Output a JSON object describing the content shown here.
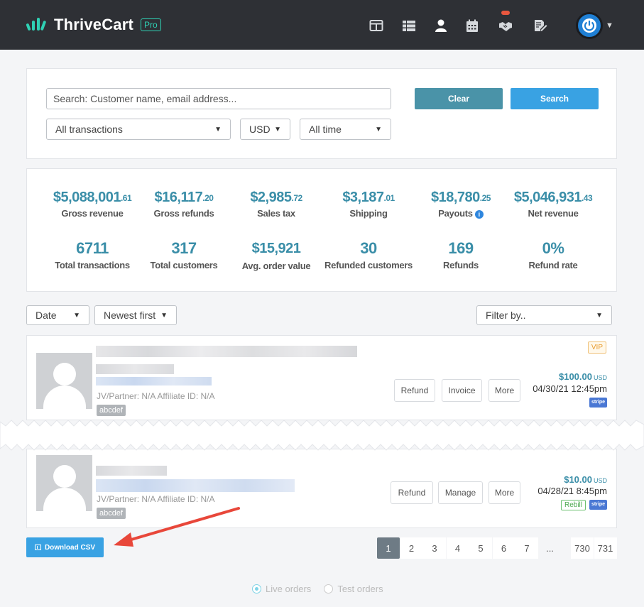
{
  "app": {
    "brand": "ThriveCart",
    "badge": "Pro"
  },
  "nav_icons": [
    "layout-icon",
    "table-list-icon",
    "user-icon",
    "calendar-icon",
    "handshake-icon",
    "edit-document-icon"
  ],
  "search": {
    "placeholder": "Search: Customer name, email address...",
    "clear_label": "Clear",
    "search_label": "Search",
    "transactions_filter": "All transactions",
    "currency": "USD",
    "period": "All time"
  },
  "stats": [
    {
      "main": "$5,088,001",
      "cents": ".61",
      "label": "Gross revenue"
    },
    {
      "main": "$16,117",
      "cents": ".20",
      "label": "Gross refunds"
    },
    {
      "main": "$2,985",
      "cents": ".72",
      "label": "Sales tax"
    },
    {
      "main": "$3,187",
      "cents": ".01",
      "label": "Shipping"
    },
    {
      "main": "$18,780",
      "cents": ".25",
      "label": "Payouts"
    },
    {
      "main": "$5,046,931",
      "cents": ".43",
      "label": "Net revenue"
    },
    {
      "main": "6711",
      "cents": "",
      "label": "Total transactions"
    },
    {
      "main": "317",
      "cents": "",
      "label": "Total customers"
    },
    {
      "main": "$15,921",
      "cents": "",
      "label": "Avg. order value"
    },
    {
      "main": "30",
      "cents": "",
      "label": "Refunded customers"
    },
    {
      "main": "169",
      "cents": "",
      "label": "Refunds"
    },
    {
      "main": "0%",
      "cents": "",
      "label": "Refund rate"
    }
  ],
  "sort": {
    "field": "Date",
    "order": "Newest first",
    "filter": "Filter by.."
  },
  "orders": [
    {
      "meta": "JV/Partner: N/A  Affiliate ID: N/A",
      "tag": "abcdef",
      "badge": "VIP",
      "buttons": [
        "Refund",
        "Invoice",
        "More"
      ],
      "amount": "$100.00",
      "currency": "USD",
      "date": "04/30/21 12:45pm",
      "gateway": "stripe"
    },
    {
      "meta": "JV/Partner: N/A  Affiliate ID: N/A",
      "tag": "abcdef",
      "badge": "Rebill",
      "buttons": [
        "Refund",
        "Manage",
        "More"
      ],
      "amount": "$10.00",
      "currency": "USD",
      "date": "04/28/21 8:45pm",
      "gateway": "stripe"
    }
  ],
  "csv_label": "Download CSV",
  "pagination": [
    "1",
    "2",
    "3",
    "4",
    "5",
    "6",
    "7",
    "...",
    "730",
    "731"
  ],
  "mode": {
    "live": "Live orders",
    "test": "Test orders"
  },
  "colors": {
    "accent": "#3a8ea8",
    "primary": "#39a2e3",
    "topbar": "#2e3035",
    "arrow": "#e8473a"
  }
}
